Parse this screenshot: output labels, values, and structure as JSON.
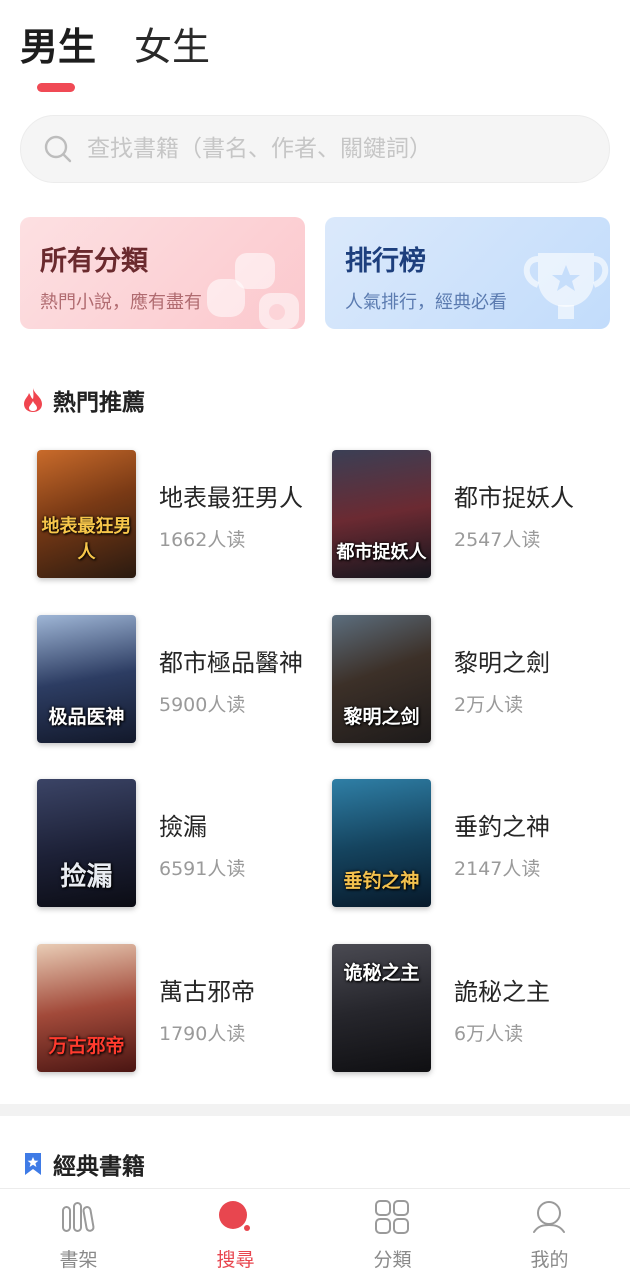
{
  "tabs": {
    "male": "男生",
    "female": "女生"
  },
  "search": {
    "placeholder": "查找書籍（書名、作者、關鍵詞）"
  },
  "cards": {
    "categories": {
      "title": "所有分類",
      "subtitle": "熱門小說，應有盡有"
    },
    "ranking": {
      "title": "排行榜",
      "subtitle": "人氣排行，經典必看"
    }
  },
  "hot": {
    "title": "熱門推薦",
    "books": [
      {
        "title": "地表最狂男人",
        "reads": "1662人读",
        "cover_text": "地表最狂男人"
      },
      {
        "title": "都市捉妖人",
        "reads": "2547人读",
        "cover_text": "都市捉妖人"
      },
      {
        "title": "都市極品醫神",
        "reads": "5900人读",
        "cover_text": "极品医神"
      },
      {
        "title": "黎明之劍",
        "reads": "2万人读",
        "cover_text": "黎明之剑"
      },
      {
        "title": "撿漏",
        "reads": "6591人读",
        "cover_text": "捡漏"
      },
      {
        "title": "垂釣之神",
        "reads": "2147人读",
        "cover_text": "垂钓之神"
      },
      {
        "title": "萬古邪帝",
        "reads": "1790人读",
        "cover_text": "万古邪帝"
      },
      {
        "title": "詭秘之主",
        "reads": "6万人读",
        "cover_text": "诡秘之主"
      }
    ]
  },
  "classic": {
    "title": "經典書籍"
  },
  "nav": [
    {
      "label": "書架",
      "icon": "bookshelf-icon"
    },
    {
      "label": "搜尋",
      "icon": "search-active-icon"
    },
    {
      "label": "分類",
      "icon": "grid-icon"
    },
    {
      "label": "我的",
      "icon": "profile-icon"
    }
  ],
  "colors": {
    "accent": "#f04a55",
    "active_nav": "#e8464f"
  }
}
